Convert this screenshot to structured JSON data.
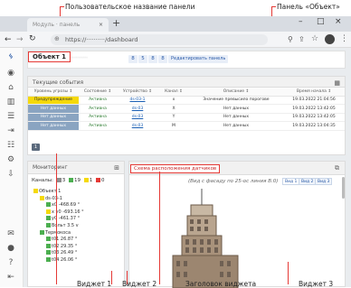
{
  "annotations": {
    "custom_panel_name": "Пользовательское название панели",
    "panel_object": "Панель «Объект»",
    "widget1": "Виджет 1",
    "widget2": "Виджет 2",
    "widget3": "Виджет 3",
    "widget_header": "Заголовок виджета"
  },
  "browser": {
    "tab_title": "Модуль · панель",
    "url": "https://··········/dashboard",
    "new_tab": "+",
    "win_min": "–",
    "win_max": "□",
    "win_close": "×"
  },
  "panel": {
    "title": "Объект 1",
    "blurred_text": "··········",
    "chips": [
      "8",
      "5",
      "8",
      "8"
    ],
    "edit_label": "Редактировать панель"
  },
  "events": {
    "title": "Текущие события",
    "columns": [
      "Уровень угрозы ↕",
      "Состояние ↕",
      "Устройство ↕",
      "Канал ↕",
      "Описание ↕",
      "Время начала ↕"
    ],
    "rows": [
      {
        "level": "Предупреждение",
        "level_style": "yel",
        "state": "Активна",
        "device": "ds-03-1",
        "channel": "x",
        "desc": "Значение превысило порогове",
        "time": "19.03.2022 21:04:56"
      },
      {
        "level": "Нет данных",
        "level_style": "blu",
        "state": "Активна",
        "device": "ds-03",
        "channel": "X",
        "desc": "Нет данных",
        "time": "19.03.2022 13:42:05"
      },
      {
        "level": "Нет данных",
        "level_style": "blu",
        "state": "Активна",
        "device": "ds-03",
        "channel": "Y",
        "desc": "Нет данных",
        "time": "19.03.2022 13:42:05"
      },
      {
        "level": "Нет данных",
        "level_style": "blu",
        "state": "Активна",
        "device": "ds-03",
        "channel": "M",
        "desc": "Нет данных",
        "time": "19.03.2022 13:04:35"
      }
    ],
    "page": "1"
  },
  "monitoring": {
    "title": "Мониторинг",
    "legend_label": "Каналы:",
    "legend": [
      {
        "count": "3",
        "color": "#8e8e8e"
      },
      {
        "count": "19",
        "color": "#4caf50"
      },
      {
        "count": "1",
        "color": "#f5d90a"
      },
      {
        "count": "0",
        "color": "#e53935"
      }
    ],
    "tree": [
      {
        "text": "Объект 1",
        "indent": 0,
        "color": "#f5d90a"
      },
      {
        "text": "ds-03-1",
        "indent": 1,
        "color": "#f5d90a"
      },
      {
        "text": "x0  -468.69 °",
        "indent": 2,
        "color": "#4caf50"
      },
      {
        "text": "x y0  -693.16 °",
        "indent": 2,
        "color": "#f5d90a"
      },
      {
        "text": "y0  -461.37 °",
        "indent": 2,
        "color": "#4caf50"
      },
      {
        "text": "Вольт  3.5 v",
        "indent": 2,
        "color": "#4caf50"
      },
      {
        "text": "Термокоса",
        "indent": 1,
        "color": "#4caf50"
      },
      {
        "text": "t01  26.87 °",
        "indent": 2,
        "color": "#4caf50"
      },
      {
        "text": "t02  29.35 °",
        "indent": 2,
        "color": "#4caf50"
      },
      {
        "text": "t03  26.49 °",
        "indent": 2,
        "color": "#4caf50"
      },
      {
        "text": "t04  26.06 °",
        "indent": 2,
        "color": "#4caf50"
      }
    ]
  },
  "diagram": {
    "title": "Схема расположения датчиков",
    "subtitle": "(Вид с фасаду по 25-ос линия В.0)",
    "view_tabs": [
      "Вид 1",
      "Вид 2",
      "Вид 3"
    ]
  }
}
